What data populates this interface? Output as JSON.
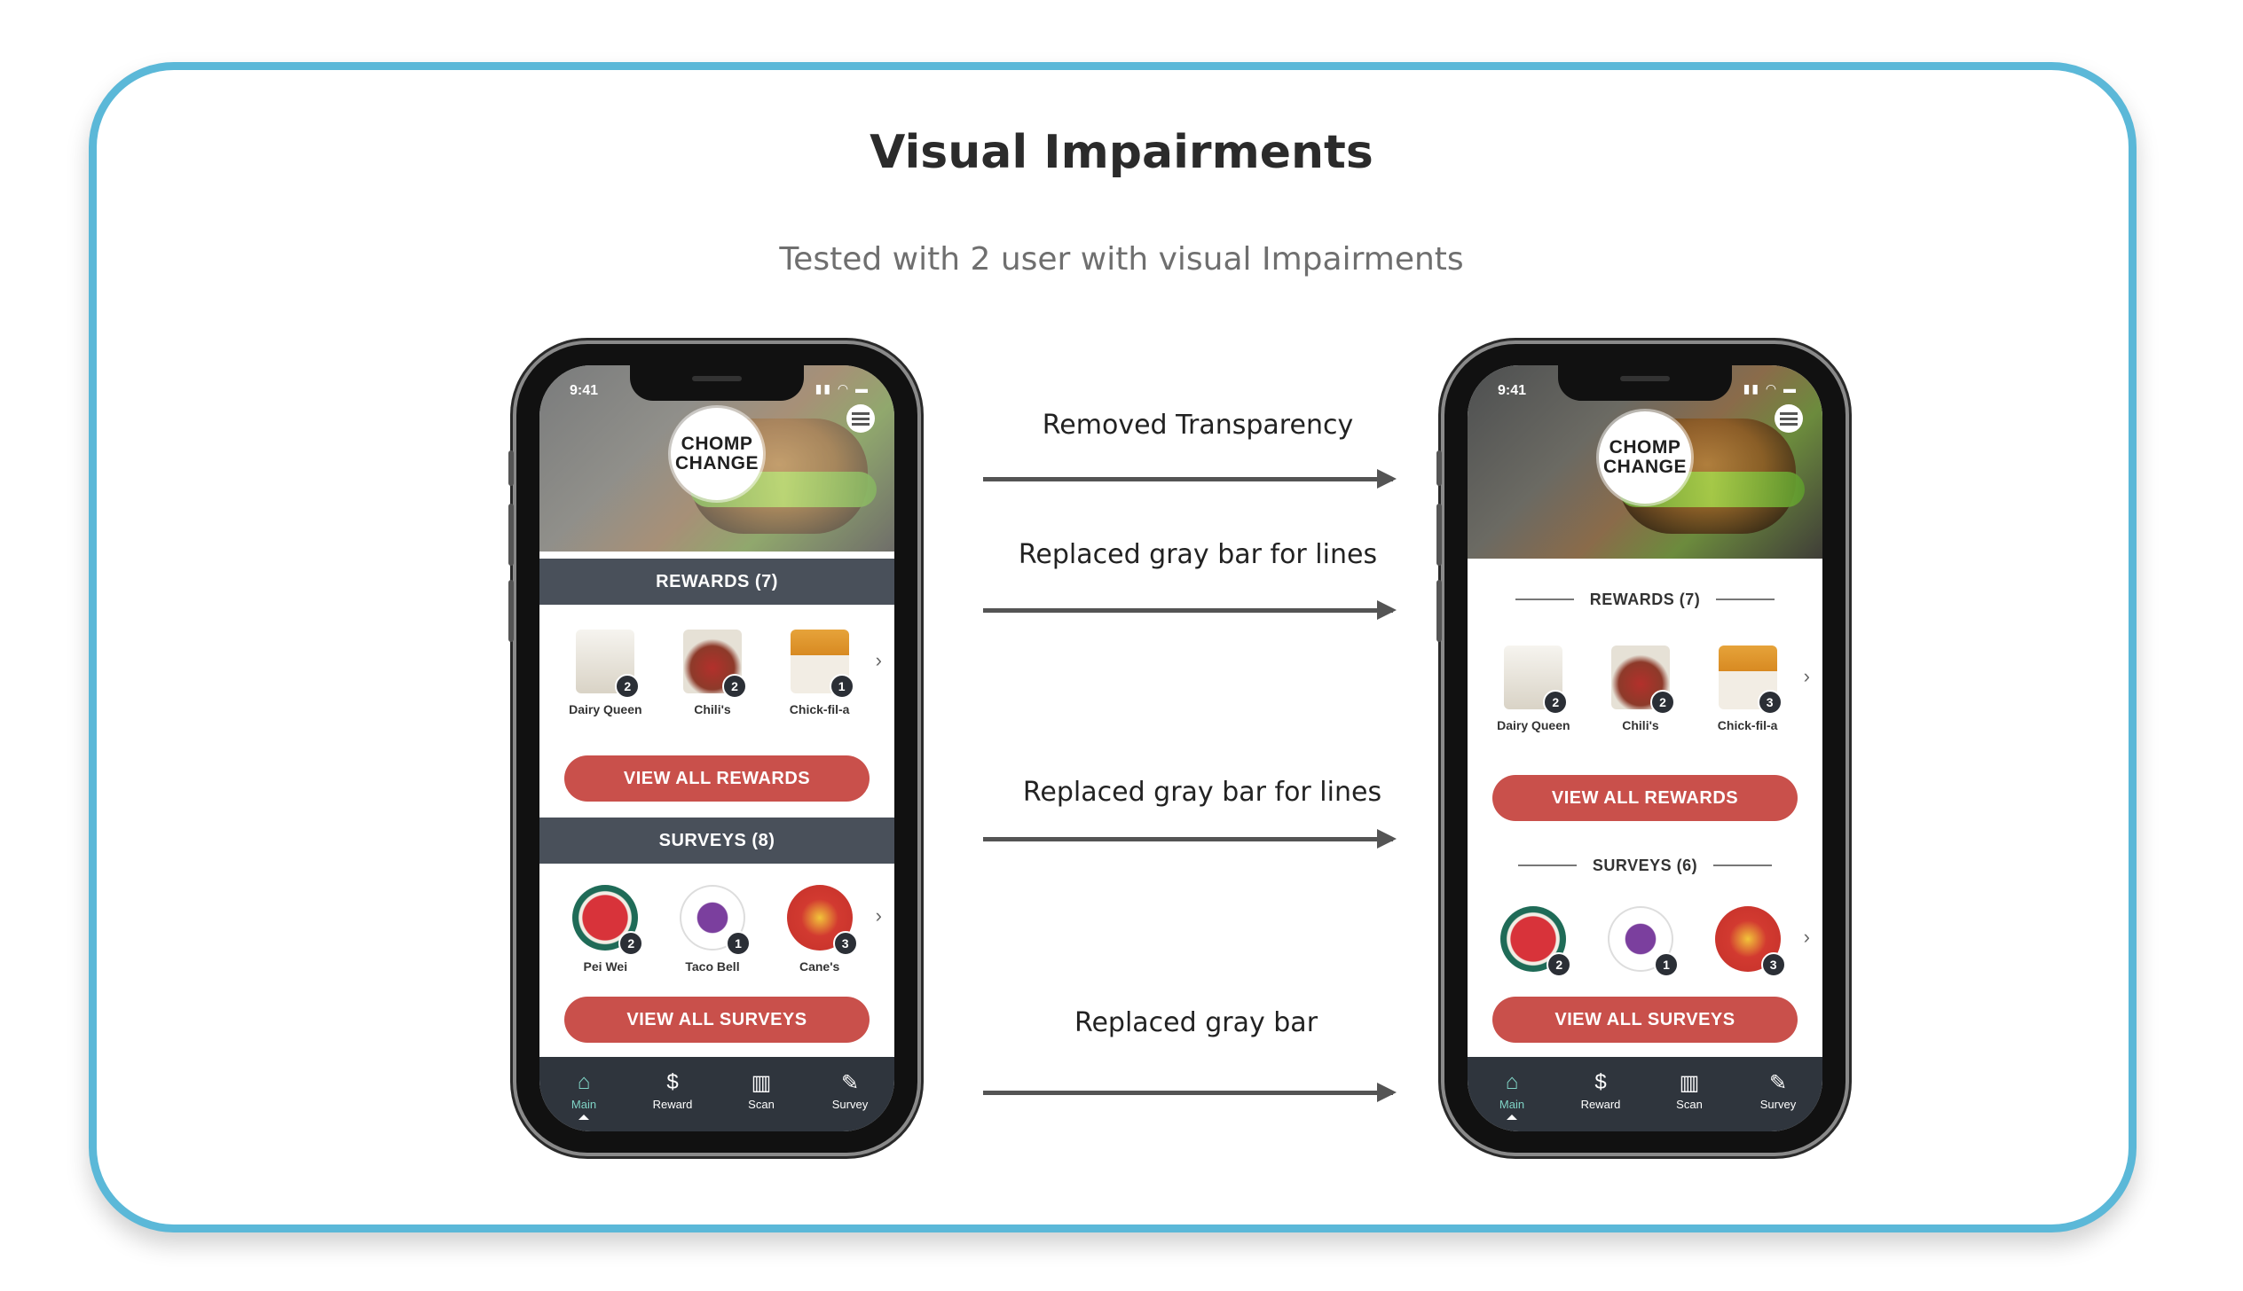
{
  "title": "Visual Impairments",
  "subtitle": "Tested with 2 user with visual Impairments",
  "colors": {
    "frame": "#5bb8d8",
    "accent": "#c9504b",
    "gray_bar": "#49505a",
    "tabbar": "#2f353d"
  },
  "phone_before": {
    "status_time": "9:41",
    "logo_line1": "CHOMP",
    "logo_line2": "CHANGE",
    "rewards_header": "REWARDS (7)",
    "rewards": [
      {
        "name": "Dairy Queen",
        "count": "2",
        "icon": "milkshake-icon"
      },
      {
        "name": "Chili's",
        "count": "2",
        "icon": "salsa-bowl-icon"
      },
      {
        "name": "Chick-fil-a",
        "count": "1",
        "icon": "fries-icon"
      }
    ],
    "view_rewards": "VIEW ALL REWARDS",
    "surveys_header": "SURVEYS (8)",
    "surveys": [
      {
        "name": "Pei Wei",
        "count": "2",
        "icon": "pei-wei-logo-icon"
      },
      {
        "name": "Taco Bell",
        "count": "1",
        "icon": "taco-bell-logo-icon"
      },
      {
        "name": "Cane's",
        "count": "3",
        "icon": "canes-logo-icon"
      }
    ],
    "view_surveys": "VIEW ALL SURVEYS",
    "tabs": [
      "Main",
      "Reward",
      "Scan",
      "Survey"
    ]
  },
  "phone_after": {
    "status_time": "9:41",
    "logo_line1": "CHOMP",
    "logo_line2": "CHANGE",
    "rewards_header": "REWARDS (7)",
    "rewards": [
      {
        "name": "Dairy Queen",
        "count": "2",
        "icon": "milkshake-icon"
      },
      {
        "name": "Chili's",
        "count": "2",
        "icon": "salsa-bowl-icon"
      },
      {
        "name": "Chick-fil-a",
        "count": "3",
        "icon": "fries-icon"
      }
    ],
    "view_rewards": "VIEW ALL REWARDS",
    "surveys_header": "SURVEYS (6)",
    "surveys": [
      {
        "name": "",
        "count": "2",
        "icon": "pei-wei-logo-icon"
      },
      {
        "name": "",
        "count": "1",
        "icon": "taco-bell-logo-icon"
      },
      {
        "name": "",
        "count": "3",
        "icon": "canes-logo-icon"
      }
    ],
    "view_surveys": "VIEW ALL SURVEYS",
    "tabs": [
      "Main",
      "Reward",
      "Scan",
      "Survey"
    ]
  },
  "annotations": [
    "Removed Transparency",
    "Replaced gray bar for lines",
    "Replaced gray bar for lines",
    "Replaced gray bar"
  ]
}
